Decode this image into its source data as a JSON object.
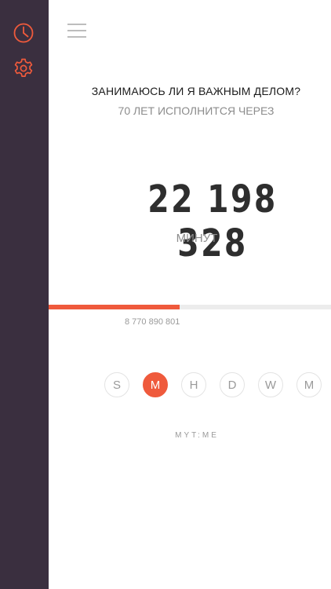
{
  "sidebar": {
    "items": [
      {
        "icon": "clock-icon"
      },
      {
        "icon": "gear-icon"
      }
    ],
    "background": "#3a2f3f",
    "accent": "#ef5a3c"
  },
  "header": {
    "menu_icon": "hamburger-menu-icon"
  },
  "main": {
    "title": "ЗАНИМАЮСЬ ЛИ Я ВАЖНЫМ ДЕЛОМ?",
    "subtitle": "70 ЛЕТ ИСПОЛНИТСЯ ЧЕРЕЗ",
    "count": "22 198 328",
    "unit": "МИНУТ",
    "progress": {
      "fraction": 0.465,
      "value_label": "8 770 890 801",
      "fill_color": "#ef5a3c"
    },
    "units": [
      {
        "label": "S",
        "active": false
      },
      {
        "label": "M",
        "active": true
      },
      {
        "label": "H",
        "active": false
      },
      {
        "label": "D",
        "active": false
      },
      {
        "label": "W",
        "active": false
      },
      {
        "label": "M",
        "active": false
      }
    ],
    "brand": "MYT:ME"
  }
}
